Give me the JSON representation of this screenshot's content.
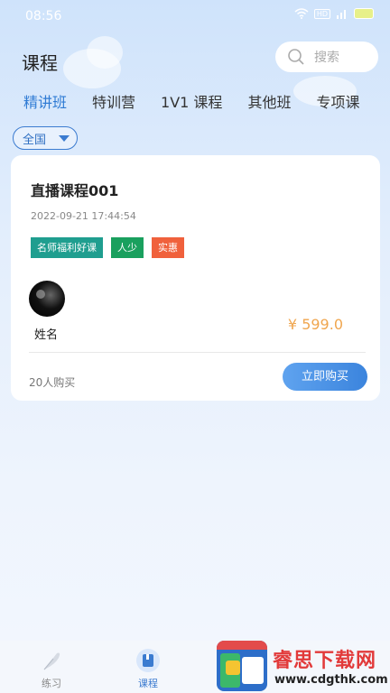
{
  "status_bar": {
    "time": "08:56",
    "network": "HD"
  },
  "header": {
    "title": "课程",
    "search_placeholder": "搜索"
  },
  "tabs": [
    {
      "label": "精讲班",
      "active": true
    },
    {
      "label": "特训营",
      "active": false
    },
    {
      "label": "1V1 课程",
      "active": false
    },
    {
      "label": "其他班",
      "active": false
    },
    {
      "label": "专项课",
      "active": false
    }
  ],
  "filter": {
    "selected": "全国"
  },
  "course": {
    "title": "直播课程001",
    "datetime": "2022-09-21 17:44:54",
    "tags": [
      {
        "label": "名师福利好课",
        "color": "#1f9e8f"
      },
      {
        "label": "人少",
        "color": "#1aa05e"
      },
      {
        "label": "实惠",
        "color": "#f0613c"
      }
    ],
    "teacher_name": "姓名",
    "price": "¥ 599.0",
    "buyers": "20人购买",
    "buy_label": "立即购买"
  },
  "bottom_nav": [
    {
      "label": "练习",
      "icon": "feather-icon",
      "active": false
    },
    {
      "label": "课程",
      "icon": "book-icon",
      "active": true
    }
  ],
  "watermark": {
    "title": "睿思下载网",
    "url": "www.cdgthk.com"
  },
  "colors": {
    "accent": "#2f7bd4",
    "price": "#f0a64f"
  }
}
